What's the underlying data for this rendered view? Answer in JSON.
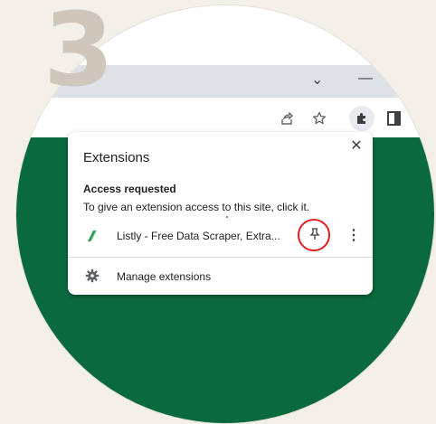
{
  "step": {
    "number": "3"
  },
  "browser": {
    "tabstrip": {
      "collapse_glyph": "⌄",
      "minimize_glyph": "—"
    },
    "toolbar": {
      "share_icon": "share-icon",
      "bookmark_icon": "star-icon",
      "extensions_icon": "puzzle-icon",
      "sidepanel_icon": "side-panel-icon"
    }
  },
  "popup": {
    "title": "Extensions",
    "close_glyph": "✕",
    "section_heading": "Access requested",
    "section_desc": "To give an extension access to this site, click it.",
    "extension": {
      "name": "Listly - Free Data Scraper, Extra...",
      "icon": "listly-icon",
      "pin_glyph": "⊥",
      "more_glyph": "⋮"
    },
    "manage": {
      "label": "Manage extensions",
      "icon": "gear-icon"
    }
  },
  "colors": {
    "page_background": "#0b6a3d",
    "highlight": "#e02020",
    "step_number": "#cfc7bc"
  }
}
